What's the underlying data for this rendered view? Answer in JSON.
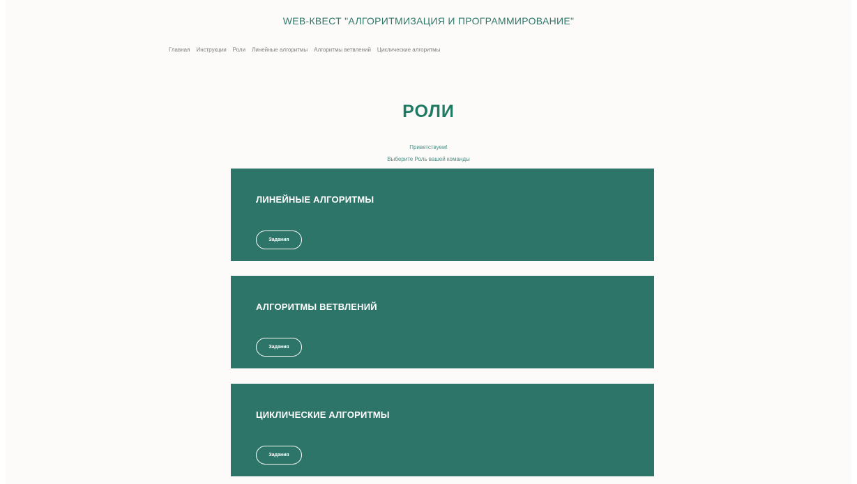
{
  "header": {
    "site_title": "WEB-КВЕСТ \"АЛГОРИТМИЗАЦИЯ И ПРОГРАММИРОВАНИЕ\""
  },
  "nav": {
    "items": [
      {
        "label": "Главная"
      },
      {
        "label": "Инструкции"
      },
      {
        "label": "Роли"
      },
      {
        "label": "Линейные алгоритмы"
      },
      {
        "label": "Алгоритмы ветвлений"
      },
      {
        "label": "Циклические алгоритмы"
      }
    ]
  },
  "main": {
    "heading": "РОЛИ",
    "greeting": "Приветствуем!",
    "subtitle": "Выберите Роль вашей команды"
  },
  "cards": [
    {
      "title": "ЛИНЕЙНЫЕ АЛГОРИТМЫ",
      "button_label": "Задания"
    },
    {
      "title": "АЛГОРИТМЫ ВЕТВЛЕНИЙ",
      "button_label": "Задания"
    },
    {
      "title": "ЦИКЛИЧЕСКИЕ АЛГОРИТМЫ",
      "button_label": "Задания"
    }
  ],
  "colors": {
    "accent": "#2e7569",
    "heading": "#1e7a62",
    "background": "#fcfbf9"
  }
}
